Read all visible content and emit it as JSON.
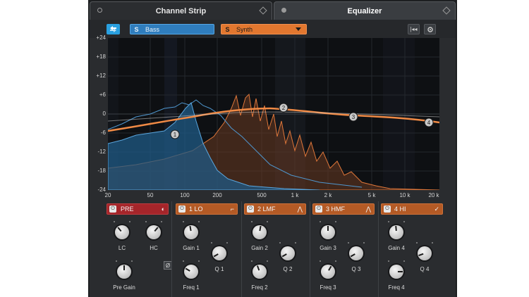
{
  "tabs": {
    "channel_strip": "Channel Strip",
    "equalizer": "Equalizer"
  },
  "toolbar": {
    "channel_a": {
      "badge": "S",
      "name": "Bass",
      "color": "#2f7dbd"
    },
    "channel_b": {
      "badge": "S",
      "name": "Synth",
      "color": "#e2772f"
    }
  },
  "graph": {
    "y_ticks": [
      "+24",
      "+18",
      "+12",
      "+6",
      "0",
      "-6",
      "-12",
      "-18",
      "-24"
    ],
    "x_ticks": [
      "20",
      "50",
      "100",
      "200",
      "500",
      "1 k",
      "2 k",
      "5 k",
      "10 k",
      "20 k"
    ],
    "nodes": [
      "1",
      "2",
      "3",
      "4"
    ]
  },
  "pre": {
    "label": "PRE",
    "lc_label": "LC",
    "hc_label": "HC",
    "phase_symbol": "Ø",
    "pre_gain_label": "Pre Gain"
  },
  "bands": [
    {
      "name": "1 LO",
      "gain_label": "Gain 1",
      "freq_label": "Freq 1",
      "q_label": "Q 1"
    },
    {
      "name": "2 LMF",
      "gain_label": "Gain 2",
      "freq_label": "Freq 2",
      "q_label": "Q 2"
    },
    {
      "name": "3 HMF",
      "gain_label": "Gain 3",
      "freq_label": "Freq 3",
      "q_label": "Q 3"
    },
    {
      "name": "4 HI",
      "gain_label": "Gain 4",
      "freq_label": "Freq 4",
      "q_label": "Q 4"
    }
  ]
}
